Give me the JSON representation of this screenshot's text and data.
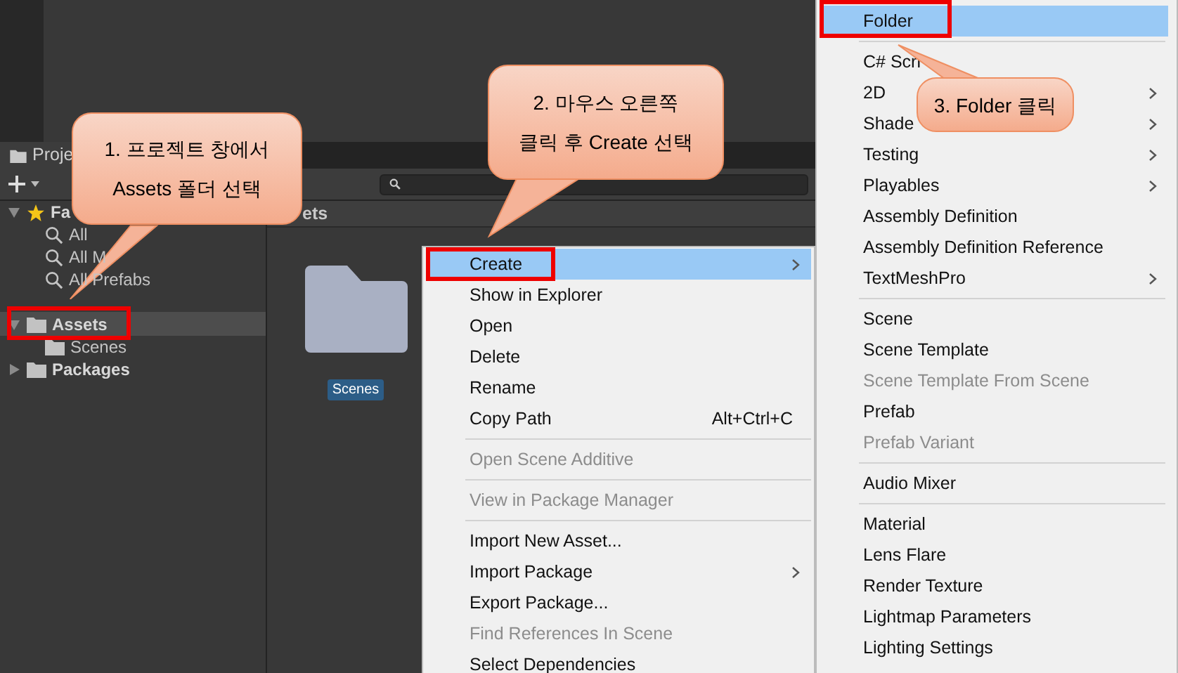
{
  "project_panel": {
    "tab": {
      "label": "Proje"
    },
    "breadcrumb": "ets",
    "tree": [
      {
        "label": "Fa",
        "kind": "favorites",
        "expanded": true,
        "selected": false,
        "children": [
          {
            "label": "All",
            "kind": "search",
            "selected": false
          },
          {
            "label": "All M",
            "kind": "search",
            "selected": false
          },
          {
            "label": "All Prefabs",
            "kind": "search",
            "selected": false
          }
        ]
      },
      {
        "label": "Assets",
        "kind": "folder",
        "expanded": true,
        "selected": true,
        "children": [
          {
            "label": "Scenes",
            "kind": "folder",
            "selected": false
          }
        ]
      },
      {
        "label": "Packages",
        "kind": "folder",
        "expanded": false,
        "selected": false
      }
    ],
    "assets": [
      {
        "label": "Scenes",
        "selected": true
      }
    ]
  },
  "context_menu": {
    "items": [
      {
        "kind": "item",
        "label": "Create",
        "selected": true,
        "disabled": false,
        "submenu": true
      },
      {
        "kind": "item",
        "label": "Show in Explorer",
        "selected": false,
        "disabled": false,
        "submenu": false
      },
      {
        "kind": "item",
        "label": "Open",
        "selected": false,
        "disabled": false,
        "submenu": false
      },
      {
        "kind": "item",
        "label": "Delete",
        "selected": false,
        "disabled": false,
        "submenu": false
      },
      {
        "kind": "item",
        "label": "Rename",
        "selected": false,
        "disabled": false,
        "submenu": false
      },
      {
        "kind": "item",
        "label": "Copy Path",
        "shortcut": "Alt+Ctrl+C",
        "selected": false,
        "disabled": false,
        "submenu": false
      },
      {
        "kind": "separator"
      },
      {
        "kind": "item",
        "label": "Open Scene Additive",
        "selected": false,
        "disabled": true,
        "submenu": false
      },
      {
        "kind": "separator"
      },
      {
        "kind": "item",
        "label": "View in Package Manager",
        "selected": false,
        "disabled": true,
        "submenu": false
      },
      {
        "kind": "separator"
      },
      {
        "kind": "item",
        "label": "Import New Asset...",
        "selected": false,
        "disabled": false,
        "submenu": false
      },
      {
        "kind": "item",
        "label": "Import Package",
        "selected": false,
        "disabled": false,
        "submenu": true
      },
      {
        "kind": "item",
        "label": "Export Package...",
        "selected": false,
        "disabled": false,
        "submenu": false
      },
      {
        "kind": "item",
        "label": "Find References In Scene",
        "selected": false,
        "disabled": true,
        "submenu": false
      },
      {
        "kind": "item",
        "label": "Select Dependencies",
        "selected": false,
        "disabled": false,
        "submenu": false
      }
    ]
  },
  "create_submenu": {
    "items": [
      {
        "kind": "item",
        "label": "Folder",
        "selected": true,
        "disabled": false,
        "submenu": false
      },
      {
        "kind": "separator"
      },
      {
        "kind": "item",
        "label": "C# Scri",
        "selected": false,
        "disabled": false,
        "submenu": false
      },
      {
        "kind": "item",
        "label": "2D",
        "selected": false,
        "disabled": false,
        "submenu": true
      },
      {
        "kind": "item",
        "label": "Shade",
        "selected": false,
        "disabled": false,
        "submenu": true
      },
      {
        "kind": "item",
        "label": "Testing",
        "selected": false,
        "disabled": false,
        "submenu": true
      },
      {
        "kind": "item",
        "label": "Playables",
        "selected": false,
        "disabled": false,
        "submenu": true
      },
      {
        "kind": "item",
        "label": "Assembly Definition",
        "selected": false,
        "disabled": false,
        "submenu": false
      },
      {
        "kind": "item",
        "label": "Assembly Definition Reference",
        "selected": false,
        "disabled": false,
        "submenu": false
      },
      {
        "kind": "item",
        "label": "TextMeshPro",
        "selected": false,
        "disabled": false,
        "submenu": true
      },
      {
        "kind": "separator"
      },
      {
        "kind": "item",
        "label": "Scene",
        "selected": false,
        "disabled": false,
        "submenu": false
      },
      {
        "kind": "item",
        "label": "Scene Template",
        "selected": false,
        "disabled": false,
        "submenu": false
      },
      {
        "kind": "item",
        "label": "Scene Template From Scene",
        "selected": false,
        "disabled": true,
        "submenu": false
      },
      {
        "kind": "item",
        "label": "Prefab",
        "selected": false,
        "disabled": false,
        "submenu": false
      },
      {
        "kind": "item",
        "label": "Prefab Variant",
        "selected": false,
        "disabled": true,
        "submenu": false
      },
      {
        "kind": "separator"
      },
      {
        "kind": "item",
        "label": "Audio Mixer",
        "selected": false,
        "disabled": false,
        "submenu": false
      },
      {
        "kind": "separator"
      },
      {
        "kind": "item",
        "label": "Material",
        "selected": false,
        "disabled": false,
        "submenu": false
      },
      {
        "kind": "item",
        "label": "Lens Flare",
        "selected": false,
        "disabled": false,
        "submenu": false
      },
      {
        "kind": "item",
        "label": "Render Texture",
        "selected": false,
        "disabled": false,
        "submenu": false
      },
      {
        "kind": "item",
        "label": "Lightmap Parameters",
        "selected": false,
        "disabled": false,
        "submenu": false
      },
      {
        "kind": "item",
        "label": "Lighting Settings",
        "selected": false,
        "disabled": false,
        "submenu": false
      }
    ]
  },
  "callouts": [
    {
      "lines": [
        "1. 프로젝트 창에서",
        "Assets 폴더 선택"
      ]
    },
    {
      "lines": [
        "2. 마우스 오른쪽",
        "클릭 후 Create 선택"
      ]
    },
    {
      "lines": [
        "3. Folder 클릭"
      ]
    }
  ]
}
